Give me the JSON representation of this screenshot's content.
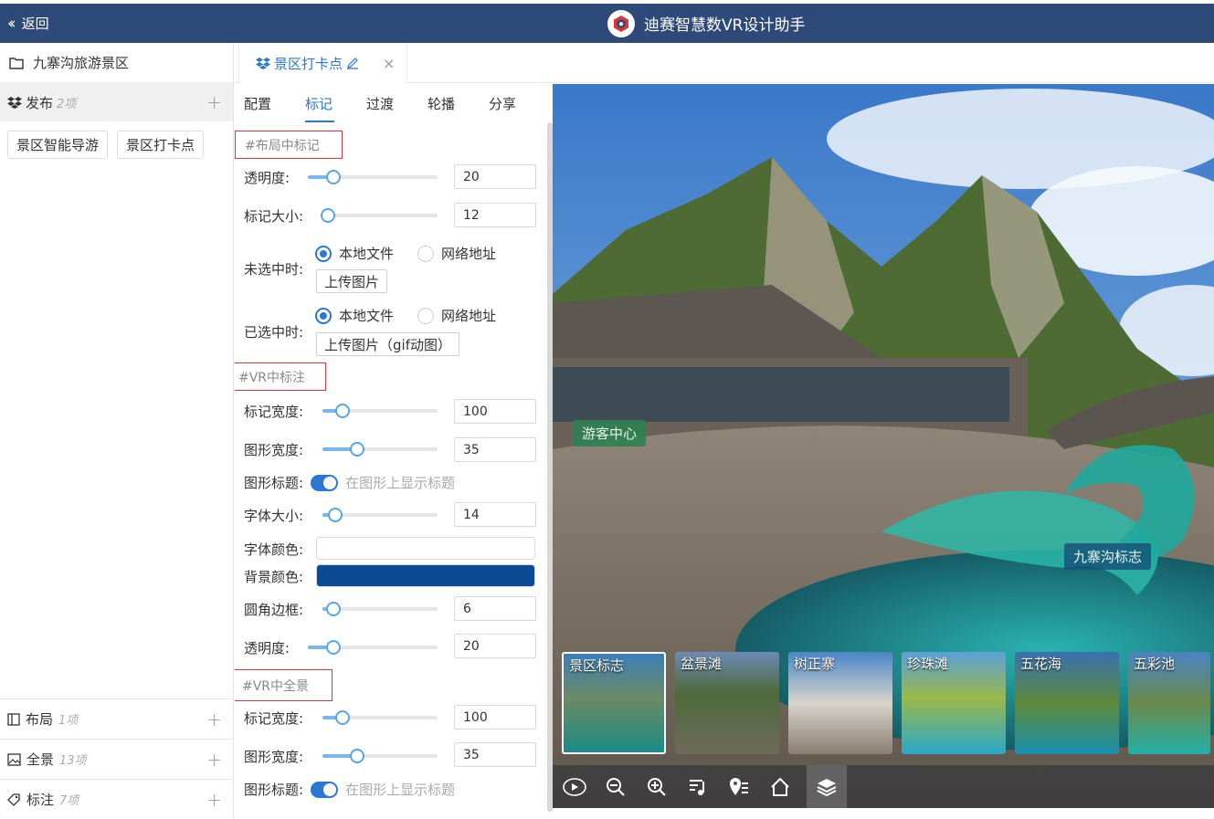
{
  "app": {
    "back_label": "返回",
    "title": "迪赛智慧数VR设计助手"
  },
  "sidebar": {
    "project": "九寨沟旅游景区",
    "publish": {
      "label": "发布",
      "count": "2项",
      "chips": [
        "景区智能导游",
        "景区打卡点"
      ]
    },
    "sections": [
      {
        "label": "布局",
        "count": "1项"
      },
      {
        "label": "全景",
        "count": "13项"
      },
      {
        "label": "标注",
        "count": "7项"
      }
    ]
  },
  "doc_tab": {
    "label": "景区打卡点"
  },
  "subtabs": [
    "配置",
    "标记",
    "过渡",
    "轮播",
    "分享"
  ],
  "panel": {
    "layout_section": "#布局中标记",
    "opacity_label": "透明度:",
    "opacity_value": "20",
    "marker_size_label": "标记大小:",
    "marker_size_value": "12",
    "unselected_label": "未选中时:",
    "selected_label": "已选中时:",
    "local_file": "本地文件",
    "network_url": "网络地址",
    "upload_image": "上传图片",
    "upload_gif": "上传图片（gif动图）",
    "vr_section": "#VR中标注",
    "marker_width_label": "标记宽度:",
    "marker_width_value": "100",
    "shape_width_label": "图形宽度:",
    "shape_width_value": "35",
    "shape_title_label": "图形标题:",
    "shape_title_hint": "在图形上显示标题",
    "font_size_label": "字体大小:",
    "font_size_value": "14",
    "font_color_label": "字体颜色:",
    "bg_color_label": "背景颜色:",
    "font_color": "#ffffff",
    "bg_color": "#0a4b94",
    "radius_label": "圆角边框:",
    "radius_value": "6",
    "opacity2_label": "透明度:",
    "opacity2_value": "20",
    "pano_section": "#VR中全景",
    "marker_width2_label": "标记宽度:",
    "marker_width2_value": "100",
    "shape_width2_label": "图形宽度:",
    "shape_width2_value": "35",
    "shape_title2_label": "图形标题:",
    "shape_title2_hint": "在图形上显示标题",
    "slider_levels": {
      "opacity": 0.2,
      "marker_size": 0.0,
      "marker_width": 0.2,
      "shape_width": 0.3,
      "font_size": 0.1,
      "radius": 0.1
    }
  },
  "vr": {
    "hotspots": [
      "游客中心",
      "九寨沟标志"
    ],
    "thumbnails": [
      "景区标志",
      "盆景滩",
      "树正寨",
      "珍珠滩",
      "五花海",
      "五彩池"
    ],
    "toolbar_icons": [
      "play-tour-icon",
      "zoom-out-icon",
      "zoom-in-icon",
      "music-icon",
      "location-list-icon",
      "home-icon",
      "layers-icon"
    ]
  }
}
